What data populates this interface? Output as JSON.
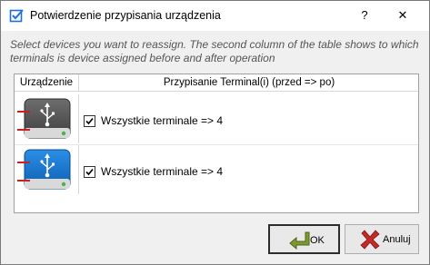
{
  "window": {
    "title": "Potwierdzenie przypisania urządzenia",
    "help_label": "?",
    "close_label": "✕"
  },
  "instructions": "Select devices you want to reassign. The second column of the table shows to which terminals is device assigned before and after operation",
  "table": {
    "columns": [
      "Urządzenie",
      "Przypisanie Terminal(i) (przed => po)"
    ],
    "rows": [
      {
        "device_icon": "usb-device-gray-icon",
        "checked": true,
        "assignment": "Wszystkie terminale => 4"
      },
      {
        "device_icon": "usb-device-blue-icon",
        "checked": true,
        "assignment": "Wszystkie terminale => 4"
      }
    ]
  },
  "buttons": {
    "ok_label": "OK",
    "cancel_label": "Anuluj"
  },
  "colors": {
    "checkbox_icon_blue": "#1e6fd9",
    "device_gray": "#5a5a5a",
    "device_blue": "#1976d2",
    "connector_red": "#cc1f1f",
    "status_green": "#4caf50",
    "ok_arrow_green": "#7c9a2d",
    "cancel_x_red": "#c62828"
  }
}
